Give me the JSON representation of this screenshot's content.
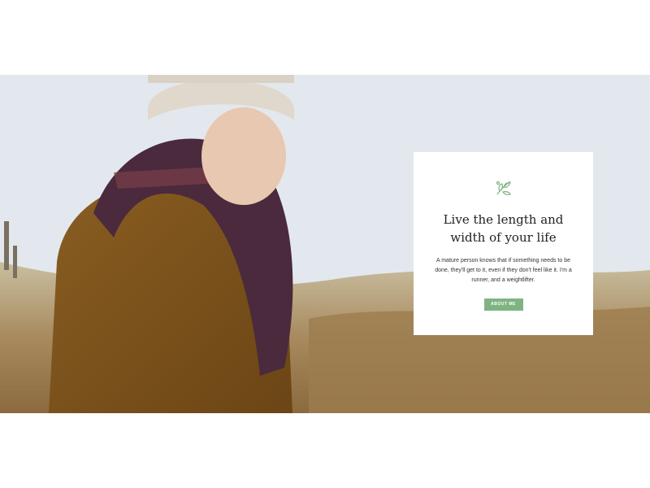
{
  "hero": {
    "card": {
      "icon": "leaf-sprig-icon",
      "title": "Live the length and width of your life",
      "text": "A mature person knows that if something needs to be done, they'll get to it, even if they don't feel like it. I'm a runner, and a weightlifter.",
      "button_label": "ABOUT ME"
    }
  },
  "colors": {
    "accent": "#7fb482",
    "card_background": "#ffffff",
    "page_background": "#ffffff"
  }
}
